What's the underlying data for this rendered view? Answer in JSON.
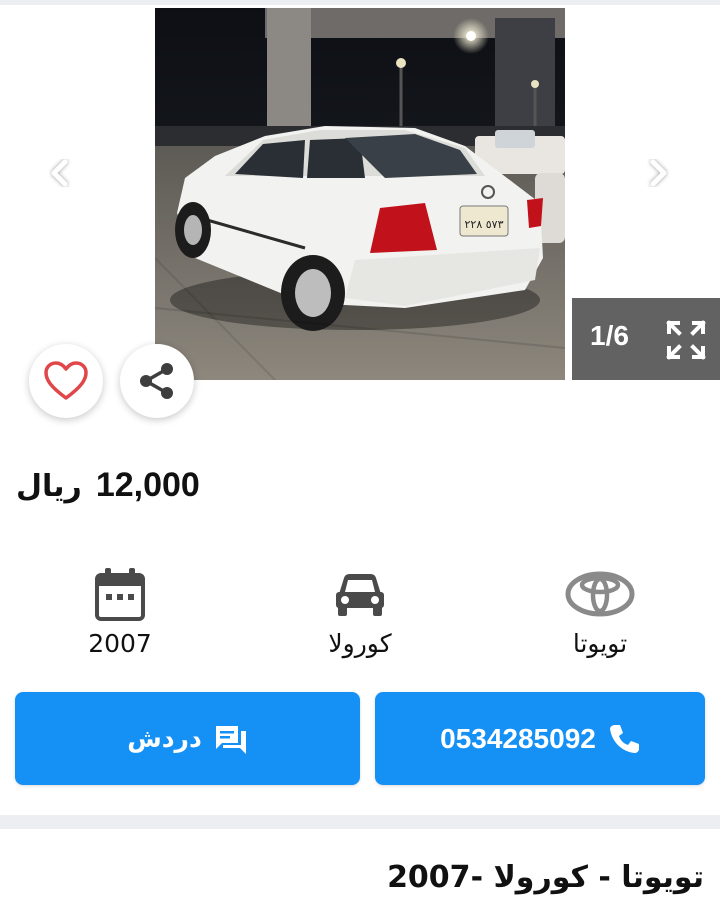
{
  "gallery": {
    "counter": "1/6",
    "current_image": 1,
    "total_images": 6,
    "plate_text": "٥٧٣ ٢٢٨"
  },
  "price": {
    "amount": "12,000",
    "currency": "ريال"
  },
  "specs": {
    "make": "تويوتا",
    "model": "كورولا",
    "year": "2007"
  },
  "actions": {
    "chat_label": "دردش",
    "phone_number": "0534285092"
  },
  "listing": {
    "title": "تويوتا - كورولا -2007"
  },
  "colors": {
    "primary_button": "#1590f5",
    "favorite_heart": "#e0464a",
    "icon_gray": "#4a4a4a",
    "counter_bg": "#464646"
  },
  "icons": {
    "prev": "chevron-left-icon",
    "next": "chevron-right-icon",
    "expand": "expand-fullscreen-icon",
    "favorite": "heart-icon",
    "share": "share-icon",
    "year": "calendar-icon",
    "model": "car-icon",
    "make": "toyota-logo-icon",
    "chat": "chat-icon",
    "call": "phone-icon"
  }
}
